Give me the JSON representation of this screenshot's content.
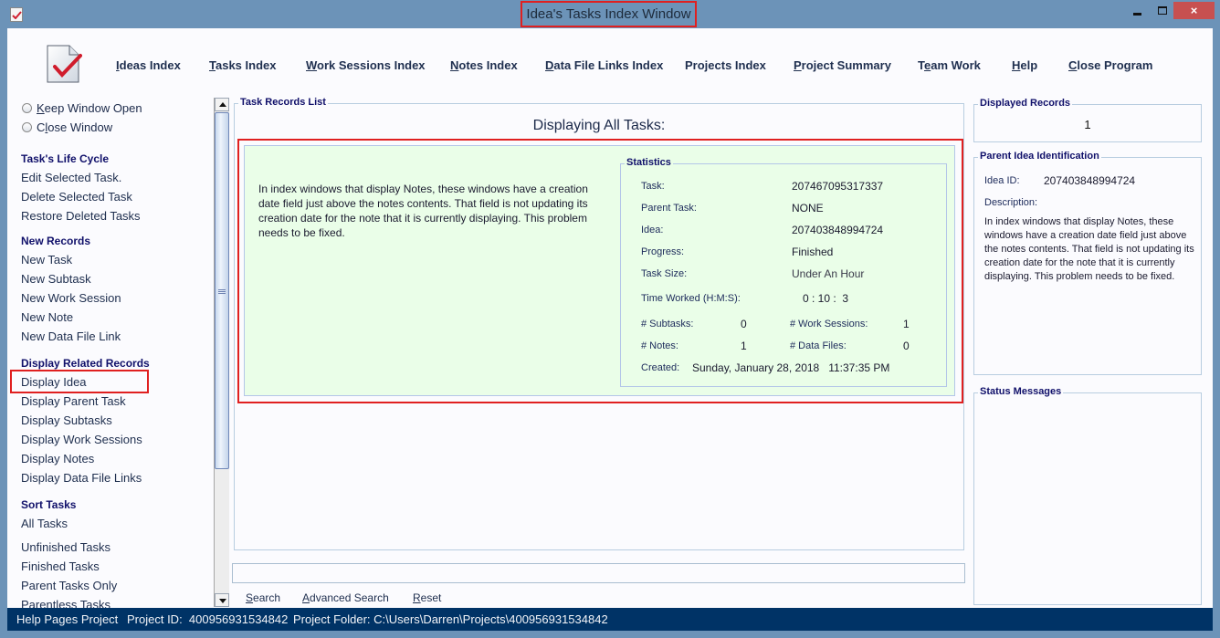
{
  "window": {
    "title": "Idea's Tasks Index Window",
    "controls": {
      "minimize": "minimize",
      "maximize": "maximize",
      "close": "×"
    }
  },
  "top_menu": [
    {
      "label": "Ideas Index",
      "mnemonic": "I",
      "rest": "deas Index"
    },
    {
      "label": "Tasks Index",
      "mnemonic": "T",
      "rest": "asks Index"
    },
    {
      "label": "Work Sessions Index",
      "mnemonic": "W",
      "rest": "ork Sessions Index"
    },
    {
      "label": "Notes Index",
      "mnemonic": "N",
      "rest": "otes Index"
    },
    {
      "label": "Data File Links Index",
      "mnemonic": "D",
      "rest": "ata File Links Index"
    },
    {
      "label": "Projects Index",
      "mnemonic": "",
      "rest": "Projects Index"
    },
    {
      "label": "Project Summary",
      "mnemonic": "P",
      "rest": "roject Summary"
    },
    {
      "label": "Team Work",
      "pre": "T",
      "mnemonic": "e",
      "rest": "am Work"
    },
    {
      "label": "Help",
      "mnemonic": "H",
      "rest": "elp"
    },
    {
      "label": "Close Program",
      "mnemonic": "C",
      "rest": "lose Program"
    }
  ],
  "left_nav": {
    "radios": [
      {
        "pre": "",
        "mnemonic": "K",
        "rest": "eep Window Open",
        "selected": false
      },
      {
        "pre": "C",
        "mnemonic": "l",
        "rest": "ose Window",
        "selected": false
      }
    ],
    "sections": [
      {
        "heading": "Task's Life Cycle",
        "items": [
          "Edit Selected Task.",
          "Delete Selected Task",
          "Restore Deleted Tasks"
        ]
      },
      {
        "heading": "New Records",
        "items": [
          "New Task",
          "New Subtask",
          "New Work Session",
          "New Note",
          "New Data File Link"
        ]
      },
      {
        "heading": "Display Related Records",
        "items": [
          "Display Idea",
          "Display Parent Task",
          "Display Subtasks",
          "Display Work Sessions",
          "Display Notes",
          "Display Data File Links"
        ]
      },
      {
        "heading": "Sort Tasks",
        "items": [
          "All Tasks",
          "Unfinished Tasks",
          "Finished Tasks",
          "Parent Tasks Only",
          "Parentless Tasks"
        ]
      }
    ],
    "highlighted_item": "Display Idea"
  },
  "records_list": {
    "group_title": "Task Records List",
    "heading": "Displaying All Tasks:",
    "record": {
      "description": "In index windows that display Notes, these windows have a creation date field just above the notes contents. That field is not updating its creation date for the note that it is currently displaying. This problem needs to be fixed.",
      "statistics": {
        "title": "Statistics",
        "task_label": "Task:",
        "task": "207467095317337",
        "parent_task_label": "Parent Task:",
        "parent_task": "NONE",
        "idea_label": "Idea:",
        "idea": "207403848994724",
        "progress_label": "Progress:",
        "progress": "Finished",
        "task_size_label": "Task Size:",
        "task_size": "Under An Hour",
        "time_worked_label": "Time Worked (H:M:S):",
        "time_worked": "0 : 10 :  3",
        "subtasks_label": "# Subtasks:",
        "subtasks": "0",
        "work_sessions_label": "# Work Sessions:",
        "work_sessions": "1",
        "notes_label": "# Notes:",
        "notes": "1",
        "data_files_label": "# Data Files:",
        "data_files": "0",
        "created_label": "Created:",
        "created": "Sunday, January 28, 2018   11:37:35 PM"
      }
    }
  },
  "search": {
    "value": "",
    "buttons": [
      {
        "mnemonic": "S",
        "rest": "earch"
      },
      {
        "mnemonic": "A",
        "rest": "dvanced Search"
      },
      {
        "mnemonic": "R",
        "rest": "eset"
      }
    ]
  },
  "right_panel": {
    "displayed_records": {
      "title": "Displayed Records",
      "count": "1"
    },
    "parent_idea": {
      "title": "Parent Idea Identification",
      "id_label": "Idea ID:",
      "id": "207403848994724",
      "description_label": "Description:",
      "description": "In index windows that display Notes, these windows have a creation date field just above the notes contents. That field is not updating its creation date for the note that it is currently displaying. This problem needs to be fixed."
    },
    "status_messages": {
      "title": "Status Messages",
      "text": ""
    }
  },
  "status_bar": {
    "project_name": "Help Pages Project",
    "project_id": "Project ID:  400956931534842",
    "project_folder": "Project Folder: C:\\Users\\Darren\\Projects\\400956931534842"
  },
  "colors": {
    "title_bar": "#6c93b8",
    "status_bar": "#003366",
    "record_card": "#eafee8",
    "annotation": "#e02020",
    "heading_text": "#10106a"
  }
}
